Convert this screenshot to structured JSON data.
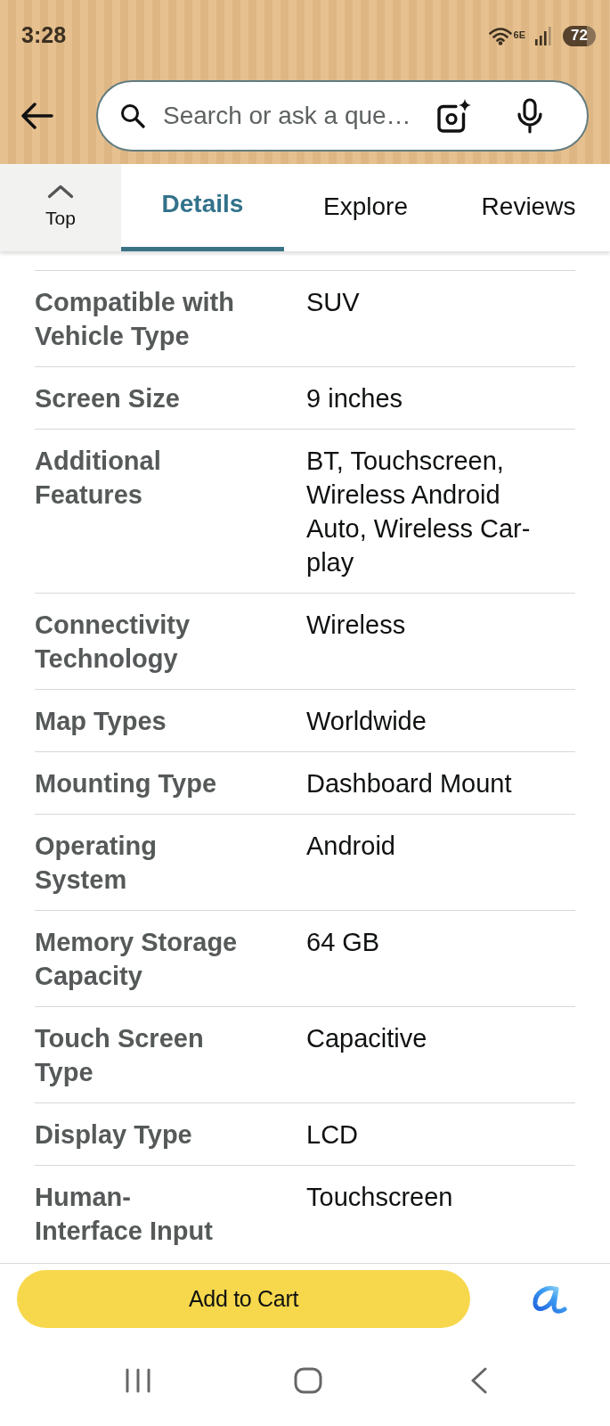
{
  "status_bar": {
    "time": "3:28",
    "network": "6E",
    "battery": "72"
  },
  "search": {
    "placeholder": "Search or ask a que…"
  },
  "top_button": {
    "label": "Top"
  },
  "tabs": [
    {
      "label": "Details",
      "selected": true
    },
    {
      "label": "Explore",
      "selected": false
    },
    {
      "label": "Reviews",
      "selected": false
    }
  ],
  "specs": [
    {
      "label": "Compatible with Vehicle Type",
      "value": "SUV"
    },
    {
      "label": "Screen Size",
      "value": "9 inches"
    },
    {
      "label": "Additional Features",
      "value": "BT, Touchscreen, Wireless Android Auto, Wireless Car-play"
    },
    {
      "label": "Connectivity Technology",
      "value": "Wireless"
    },
    {
      "label": "Map Types",
      "value": "Worldwide"
    },
    {
      "label": "Mounting Type",
      "value": "Dashboard Mount"
    },
    {
      "label": "Operating System",
      "value": "Android"
    },
    {
      "label": "Memory Storage Capacity",
      "value": "64 GB"
    },
    {
      "label": "Touch Screen Type",
      "value": "Capacitive"
    },
    {
      "label": "Display Type",
      "value": "LCD"
    },
    {
      "label": "Human-Interface Input",
      "value": "Touchscreen"
    }
  ],
  "cart_button": {
    "label": "Add to Cart"
  }
}
